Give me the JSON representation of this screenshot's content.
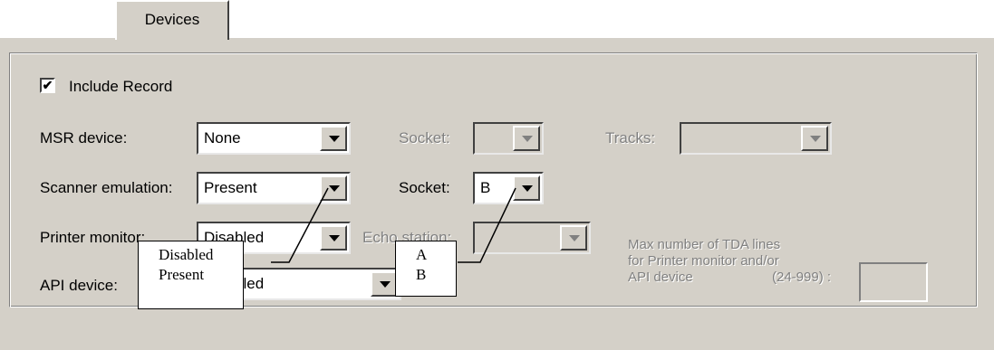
{
  "tab": {
    "label": "Devices"
  },
  "include_record": {
    "label": "Include Record",
    "checked": true
  },
  "rows": {
    "msr": {
      "label": "MSR device:",
      "value": "None"
    },
    "msr_socket": {
      "label": "Socket:",
      "value": ""
    },
    "tracks": {
      "label": "Tracks:",
      "value": ""
    },
    "scanner": {
      "label": "Scanner emulation:",
      "value": "Present"
    },
    "scanner_socket": {
      "label": "Socket:",
      "value": "B"
    },
    "printer": {
      "label": "Printer monitor:",
      "value": "Disabled"
    },
    "echo_station": {
      "label": "Echo station:",
      "value": ""
    },
    "api": {
      "label": "API device:",
      "value": "Disabled"
    }
  },
  "max_tda": {
    "line1": "Max number of TDA lines",
    "line2": "for Printer monitor and/or",
    "line3": "API device",
    "range": "(24-999) :",
    "value": ""
  },
  "callout_scanner": {
    "line1": "Disabled",
    "line2": "Present"
  },
  "callout_socket": {
    "line1": "A",
    "line2": "B"
  },
  "colors": {
    "dialog": "#d4d0c8",
    "disabled_text": "#808080"
  }
}
